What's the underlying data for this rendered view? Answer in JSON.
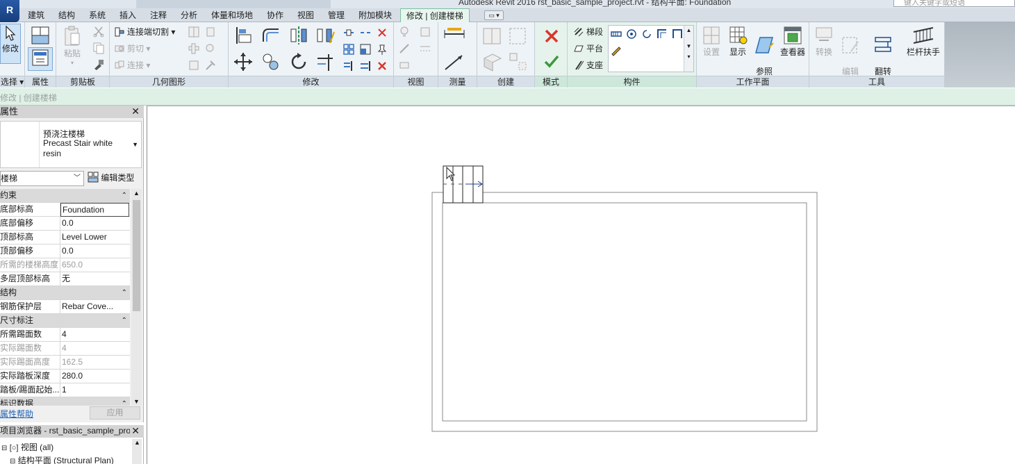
{
  "title_bar": {
    "title": "Autodesk Revit 2016      rst_basic_sample_project.rvt - 结构平面: Foundation",
    "search_placeholder": "键入关键字或短语",
    "app_button": "R"
  },
  "tabs": [
    {
      "label": "建筑"
    },
    {
      "label": "结构"
    },
    {
      "label": "系统"
    },
    {
      "label": "插入"
    },
    {
      "label": "注释"
    },
    {
      "label": "分析"
    },
    {
      "label": "体量和场地"
    },
    {
      "label": "协作"
    },
    {
      "label": "视图"
    },
    {
      "label": "管理"
    },
    {
      "label": "附加模块"
    },
    {
      "label": "修改 | 创建楼梯",
      "active": true
    },
    {
      "label": "▭ ▾"
    }
  ],
  "ribbon": {
    "select": {
      "modify_label": "修改",
      "panel_label": "选择 ▾"
    },
    "properties": {
      "panel_label": "属性"
    },
    "clipboard": {
      "paste_label": "粘贴",
      "panel_label": "剪贴板"
    },
    "geometry": {
      "items": [
        "连接端切割 ▾",
        "剪切 ▾",
        "连接 ▾"
      ],
      "panel_label": "几何图形"
    },
    "modify": {
      "panel_label": "修改"
    },
    "view": {
      "panel_label": "视图"
    },
    "measure": {
      "panel_label": "测量"
    },
    "create": {
      "panel_label": "创建"
    },
    "mode": {
      "panel_label": "模式"
    },
    "components": {
      "items": [
        "梯段",
        "平台",
        "支座"
      ],
      "panel_label": "构件"
    },
    "work_plane": {
      "buttons": [
        "设置",
        "显示",
        "参照\n平面",
        "查看器"
      ],
      "panel_label": "工作平面"
    },
    "tools": {
      "buttons": [
        "转换",
        "编辑\n草图",
        "翻转",
        "栏杆扶手"
      ],
      "panel_label": "工具"
    }
  },
  "option_bar": {
    "label": "修改 | 创建楼梯"
  },
  "properties": {
    "header": "属性",
    "type_name_line1": "预浇注楼梯",
    "type_name_line2": "Precast Stair white resin",
    "category": "楼梯",
    "edit_type_label": "编辑类型",
    "groups": [
      {
        "title": "约束",
        "rows": [
          {
            "key": "底部标高",
            "value": "Foundation",
            "selected": true
          },
          {
            "key": "底部偏移",
            "value": "0.0"
          },
          {
            "key": "顶部标高",
            "value": "Level Lower"
          },
          {
            "key": "顶部偏移",
            "value": "0.0"
          },
          {
            "key": "所需的楼梯高度",
            "value": "650.0",
            "readonly": true
          },
          {
            "key": "多层顶部标高",
            "value": "无"
          }
        ]
      },
      {
        "title": "结构",
        "rows": [
          {
            "key": "钢筋保护层",
            "value": "Rebar Cove..."
          }
        ]
      },
      {
        "title": "尺寸标注",
        "rows": [
          {
            "key": "所需踢面数",
            "value": "4"
          },
          {
            "key": "实际踢面数",
            "value": "4",
            "readonly": true
          },
          {
            "key": "实际踢面高度",
            "value": "162.5",
            "readonly": true
          },
          {
            "key": "实际踏板深度",
            "value": "280.0"
          },
          {
            "key": "踏板/踢面起始...",
            "value": "1"
          }
        ]
      },
      {
        "title": "标识数据",
        "rows": []
      }
    ],
    "help_link": "属性帮助",
    "apply_label": "应用"
  },
  "project_browser": {
    "header": "项目浏览器 - rst_basic_sample_proj...",
    "items": [
      "视图 (all)",
      "结构平面 (Structural Plan)"
    ]
  },
  "colors": {
    "context_tab": "#e6f3ec",
    "panel_label": "#d7e0e8",
    "accent_red": "#d9352b",
    "accent_green": "#3c9a3c"
  }
}
